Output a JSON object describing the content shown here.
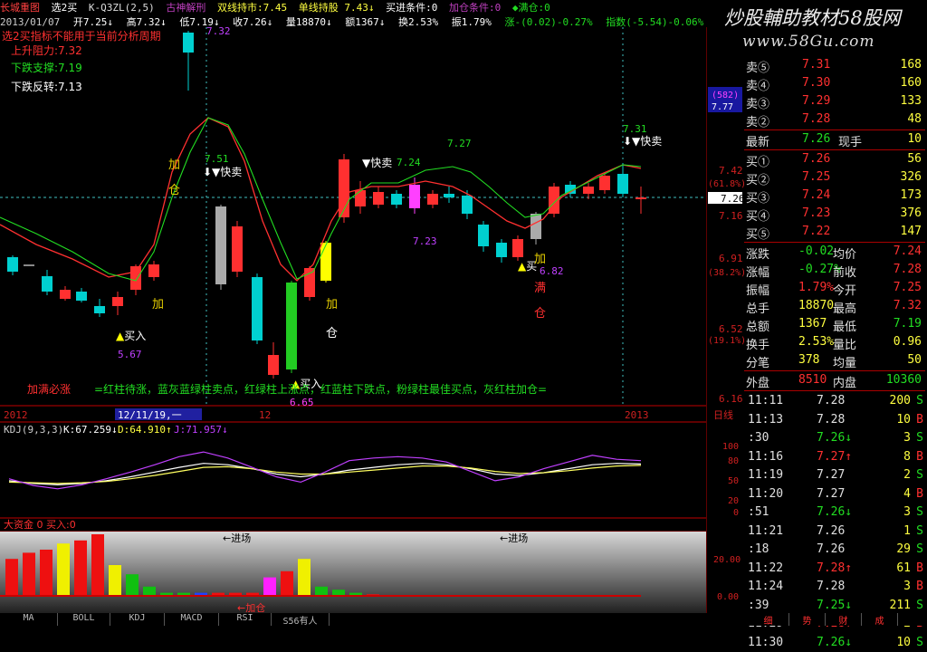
{
  "header": {
    "app": "长城重图",
    "items": [
      "选2买",
      "K-Q3ZL(2,5)",
      "古神解刑",
      "双线持市:7.45",
      "单线持股 7.43↓",
      "买进条件:0",
      "加仓条件:0",
      "◆满仓:0"
    ]
  },
  "ohlc_row": {
    "date": "2013/01/07",
    "items": [
      "开7.25↓",
      "高7.32↓",
      "低7.19↓",
      "收7.26↓",
      "量18870↓",
      "额1367↓",
      "换2.53%",
      "振1.79%",
      "涨-(0.02)-0.27%",
      "指数(-5.54)-0.06%"
    ]
  },
  "watermark": {
    "line1": "炒股輔助教材58股网",
    "line2": "www.58Gu.com"
  },
  "chart_data": [
    {
      "type": "candlestick",
      "title": "",
      "notes": [
        "选2买指标不能用于当前分析周期",
        "上升阻力:7.32",
        "下跌支撑:7.19",
        "下跌反转:7.13"
      ],
      "y_ticks": [
        "7.42",
        "(61.8%)",
        "7.16",
        "6.91",
        "(38.2%)",
        "6.52",
        "(19.1%)",
        "6.16"
      ],
      "price_tag": "7.26",
      "box_labels": [
        "(582)",
        "7.77"
      ],
      "x_ticks": [
        "2012",
        "12/11/19,一",
        "12",
        "2013",
        "日线"
      ],
      "signals": [
        "买入",
        "快卖",
        "快卖",
        "快卖",
        "买入",
        "加仓",
        "加仓",
        "加仓",
        "加仓"
      ],
      "labels": [
        "7.32",
        "7.51",
        "7.24",
        "7.27",
        "7.23",
        "7.31",
        "5.67",
        "6.65",
        "6.82"
      ],
      "legend_text": "加满必涨",
      "legend_desc": "=红柱待涨，蓝灰蓝绿柱卖点，红绿柱上涨点，红蓝柱下跌点，粉绿柱最佳买点，灰红柱加仓="
    },
    {
      "type": "line",
      "title": "KDJ(9,3,3)",
      "values_text": [
        "K:67.259↓",
        "D:64.910↑",
        "J:71.957↓"
      ],
      "y_ticks": [
        "100",
        "80",
        "50",
        "20",
        "0"
      ],
      "series": [
        {
          "name": "K",
          "values": [
            42,
            38,
            36,
            38,
            42,
            48,
            55,
            62,
            68,
            66,
            60,
            52,
            48,
            52,
            58,
            62,
            66,
            68,
            66,
            60,
            52,
            50,
            54,
            60,
            66,
            68,
            67
          ]
        },
        {
          "name": "D",
          "values": [
            40,
            39,
            38,
            39,
            41,
            45,
            50,
            56,
            62,
            63,
            60,
            55,
            52,
            52,
            55,
            58,
            61,
            64,
            64,
            61,
            56,
            53,
            54,
            57,
            61,
            64,
            65
          ]
        },
        {
          "name": "J",
          "values": [
            45,
            35,
            30,
            36,
            45,
            55,
            66,
            78,
            85,
            76,
            62,
            48,
            40,
            55,
            72,
            76,
            78,
            76,
            70,
            56,
            42,
            48,
            60,
            70,
            80,
            74,
            72
          ]
        }
      ]
    },
    {
      "type": "bar",
      "title": "大资金 0 买入:0",
      "y_ticks": [
        "20.00",
        "0.00"
      ],
      "annotations": [
        "←进场",
        "←进场",
        "←加仓"
      ],
      "values": [
        12,
        14,
        15,
        17,
        18,
        20,
        10,
        7,
        3,
        1,
        1,
        1,
        1,
        1,
        1,
        6,
        8,
        12,
        3,
        2,
        1,
        0.5,
        0.3,
        0.2
      ],
      "colors": [
        "red",
        "red",
        "red",
        "yellow",
        "red",
        "red",
        "yellow",
        "green",
        "green",
        "green",
        "green",
        "blue",
        "red",
        "red",
        "red",
        "magenta",
        "red",
        "yellow",
        "green",
        "green",
        "green",
        "red",
        "red",
        "red"
      ]
    }
  ],
  "quotes": {
    "sell": [
      {
        "label": "卖⑤",
        "price": "7.31",
        "vol": "168"
      },
      {
        "label": "卖④",
        "price": "7.30",
        "vol": "160"
      },
      {
        "label": "卖③",
        "price": "7.29",
        "vol": "133"
      },
      {
        "label": "卖②",
        "price": "7.28",
        "vol": "48"
      }
    ],
    "latest": {
      "label": "最新",
      "price": "7.26",
      "k": "现手",
      "v": "10"
    },
    "buy": [
      {
        "label": "买①",
        "price": "7.26",
        "vol": "56"
      },
      {
        "label": "买②",
        "price": "7.25",
        "vol": "326"
      },
      {
        "label": "买③",
        "price": "7.24",
        "vol": "173"
      },
      {
        "label": "买④",
        "price": "7.23",
        "vol": "376"
      },
      {
        "label": "买⑤",
        "price": "7.22",
        "vol": "147"
      }
    ],
    "stats": [
      {
        "k1": "涨跌",
        "v1": "-0.02",
        "k2": "均价",
        "v2": "7.24"
      },
      {
        "k1": "涨幅",
        "v1": "-0.27%",
        "k2": "前收",
        "v2": "7.28"
      },
      {
        "k1": "振幅",
        "v1": "1.79%",
        "k2": "今开",
        "v2": "7.25"
      },
      {
        "k1": "总手",
        "v1": "18870",
        "k2": "最高",
        "v2": "7.32"
      },
      {
        "k1": "总额",
        "v1": "1367",
        "k2": "最低",
        "v2": "7.19"
      },
      {
        "k1": "换手",
        "v1": "2.53%",
        "k2": "量比",
        "v2": "0.96"
      },
      {
        "k1": "分笔",
        "v1": "378",
        "k2": "均量",
        "v2": "50"
      }
    ],
    "outer": {
      "k1": "外盘",
      "v1": "8510",
      "k2": "内盘",
      "v2": "10360"
    }
  },
  "ticks": [
    {
      "t": "11:11",
      "p": "7.28",
      "v": "200",
      "s": "S"
    },
    {
      "t": "11:13",
      "p": "7.28",
      "v": "10",
      "s": "B"
    },
    {
      "t": ":30",
      "p": "7.26↓",
      "v": "3",
      "s": "S"
    },
    {
      "t": "11:16",
      "p": "7.27↑",
      "v": "8",
      "s": "B"
    },
    {
      "t": "11:19",
      "p": "7.27",
      "v": "2",
      "s": "S"
    },
    {
      "t": "11:20",
      "p": "7.27",
      "v": "4",
      "s": "B"
    },
    {
      "t": ":51",
      "p": "7.26↓",
      "v": "3",
      "s": "S"
    },
    {
      "t": "11:21",
      "p": "7.26",
      "v": "1",
      "s": "S"
    },
    {
      "t": ":18",
      "p": "7.26",
      "v": "29",
      "s": "S"
    },
    {
      "t": "11:22",
      "p": "7.28↑",
      "v": "61",
      "s": "B"
    },
    {
      "t": "11:24",
      "p": "7.28",
      "v": "3",
      "s": "B"
    },
    {
      "t": ":39",
      "p": "7.25↓",
      "v": "211",
      "s": "S"
    },
    {
      "t": "11:29",
      "p": "7.28↑",
      "v": "2",
      "s": "B"
    },
    {
      "t": "11:30",
      "p": "7.26↓",
      "v": "10",
      "s": "S"
    }
  ],
  "bottom_tabs": [
    "MA",
    "BOLL",
    "KDJ",
    "MACD",
    "RSI",
    "S56有人"
  ],
  "side_tabs": [
    "细",
    "势",
    "财",
    "成"
  ],
  "colors": {
    "up": "#ff3030",
    "down": "#00d0d0",
    "accent_yellow": "#ffff00",
    "label_yellow": "#e8d000",
    "green": "#22cc22",
    "grid": "#990000",
    "axis_text": "#d02020"
  }
}
